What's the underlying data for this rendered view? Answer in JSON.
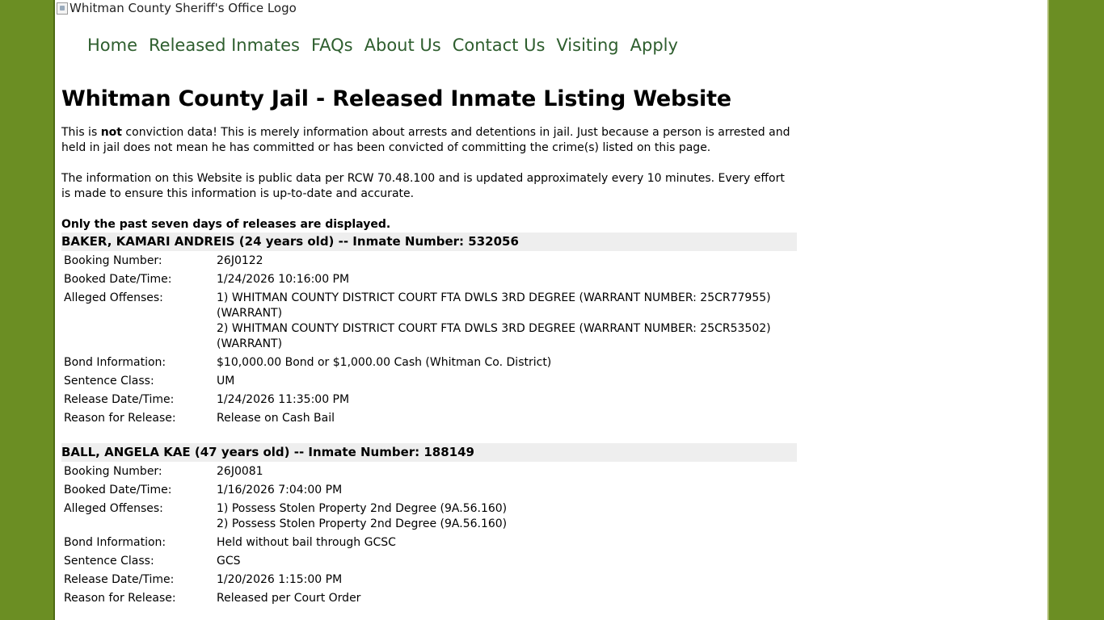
{
  "logo": {
    "alt": "Whitman County Sheriff's Office Logo"
  },
  "nav": [
    "Home",
    "Released Inmates",
    "FAQs",
    "About Us",
    "Contact Us",
    "Visiting",
    "Apply"
  ],
  "title": "Whitman County Jail - Released Inmate Listing Website",
  "disclaimer": {
    "pre": "This is ",
    "bold": "not",
    "post": " conviction data! This is merely information about arrests and detentions in jail. Just because a person is arrested and held in jail does not mean he has committed or has been convicted of committing the crime(s) listed on this page."
  },
  "info": "The information on this Website is public data per RCW 70.48.100 and is updated approximately every 10 minutes. Every effort is made to ensure this information is up-to-date and accurate.",
  "notice": "Only the past seven days of releases are displayed.",
  "labels": {
    "booking": "Booking Number:",
    "booked": "Booked Date/Time:",
    "offenses": "Alleged Offenses:",
    "bond": "Bond Information:",
    "sentence": "Sentence Class:",
    "release": "Release Date/Time:",
    "reason": "Reason for Release:"
  },
  "inmates": [
    {
      "header": "BAKER, KAMARI ANDREIS (24 years old) -- Inmate Number: 532056",
      "booking": "26J0122",
      "booked": "1/24/2026 10:16:00 PM",
      "offenses": [
        "1) WHITMAN COUNTY DISTRICT COURT FTA DWLS 3RD DEGREE (WARRANT NUMBER: 25CR77955) (WARRANT)",
        "2) WHITMAN COUNTY DISTRICT COURT FTA DWLS 3RD DEGREE (WARRANT NUMBER: 25CR53502) (WARRANT)"
      ],
      "bond": "$10,000.00 Bond or $1,000.00 Cash (Whitman Co. District)",
      "sentence": "UM",
      "release": "1/24/2026 11:35:00 PM",
      "reason": "Release on Cash Bail"
    },
    {
      "header": "BALL, ANGELA KAE (47 years old) -- Inmate Number: 188149",
      "booking": "26J0081",
      "booked": "1/16/2026 7:04:00 PM",
      "offenses": [
        "1) Possess Stolen Property 2nd Degree (9A.56.160)",
        "2) Possess Stolen Property 2nd Degree (9A.56.160)"
      ],
      "bond": "Held without bail through GCSC",
      "sentence": "GCS",
      "release": "1/20/2026 1:15:00 PM",
      "reason": "Released per Court Order"
    }
  ]
}
